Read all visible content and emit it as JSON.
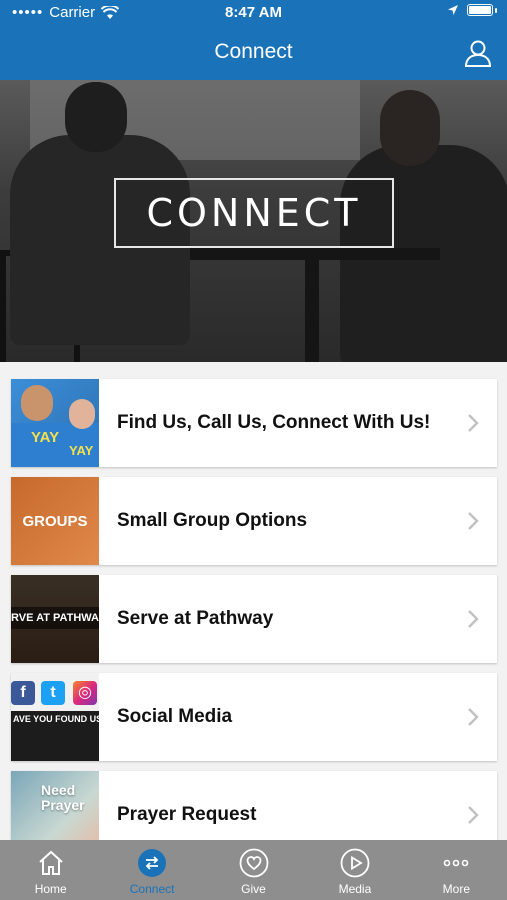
{
  "status": {
    "carrier": "Carrier",
    "time": "8:47 AM"
  },
  "nav": {
    "title": "Connect"
  },
  "hero": {
    "title": "CONNECT"
  },
  "items": [
    {
      "label": "Find Us, Call Us, Connect With Us!",
      "thumb_text": "YAY"
    },
    {
      "label": "Small Group Options",
      "thumb_text": "GROUPS"
    },
    {
      "label": "Serve at Pathway",
      "thumb_text": "RVE AT PATHWA"
    },
    {
      "label": "Social Media",
      "thumb_text": "AVE YOU FOUND US YE"
    },
    {
      "label": "Prayer Request",
      "thumb_text": "Need Prayer"
    }
  ],
  "tabs": [
    {
      "label": "Home",
      "icon": "home-icon"
    },
    {
      "label": "Connect",
      "icon": "connect-icon"
    },
    {
      "label": "Give",
      "icon": "give-icon"
    },
    {
      "label": "Media",
      "icon": "media-icon"
    },
    {
      "label": "More",
      "icon": "more-icon"
    }
  ],
  "colors": {
    "brand_blue": "#1a73b8",
    "tab_bar": "#8e8e8e"
  }
}
